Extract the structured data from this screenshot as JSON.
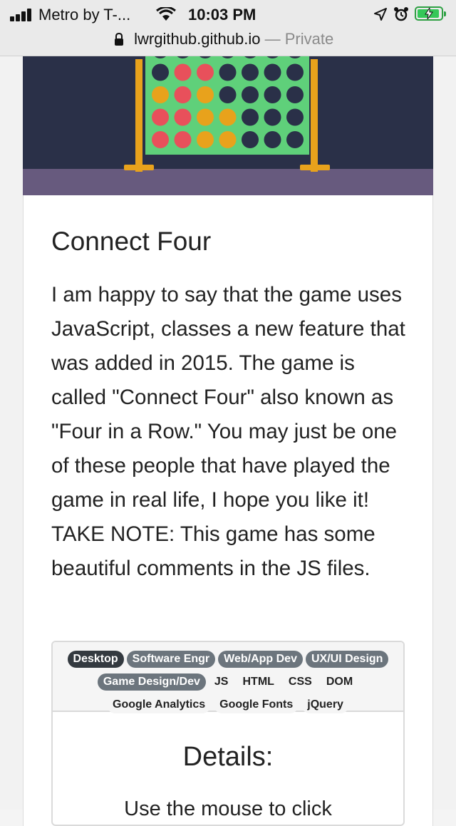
{
  "status_bar": {
    "carrier": "Metro by T-...",
    "time": "10:03 PM"
  },
  "url_bar": {
    "domain": "lwrgithub.github.io",
    "separator": "—",
    "mode": "Private"
  },
  "banner": {
    "board_color": "#5fd07a",
    "stand_color": "#e8a21c",
    "background_color": "#2a3048",
    "floor_color": "#675a7e",
    "piece_colors": {
      "R": "#e8505b",
      "Y": "#e8a21c",
      "E": "#2a3048"
    },
    "board_rows": [
      "EEEEEEE",
      "ERREEEE",
      "YRYEEEE",
      "RRYYEEE",
      "RRYYEEE"
    ]
  },
  "project": {
    "title": "Connect Four",
    "description": "I am happy to say that the game uses JavaScript, classes a new feature that was added in 2015. The game is called \"Connect Four\" also known as \"Four in a Row.\" You may just be one of these people that have played the game in real life, I hope you like it! TAKE NOTE: This game has some beautiful comments in the JS files."
  },
  "tags": {
    "row1": [
      {
        "label": "Desktop",
        "style": "dark"
      },
      {
        "label": "Software Engr",
        "style": "gray"
      },
      {
        "label": "Web/App Dev",
        "style": "gray"
      },
      {
        "label": "UX/UI Design",
        "style": "gray"
      }
    ],
    "row2": [
      {
        "label": "Game Design/Dev",
        "style": "gray"
      },
      {
        "label": "JS",
        "style": "light"
      },
      {
        "label": "HTML",
        "style": "light"
      },
      {
        "label": "CSS",
        "style": "light"
      },
      {
        "label": "DOM",
        "style": "light"
      }
    ],
    "row3": [
      {
        "label": "Google Analytics",
        "style": "light"
      },
      {
        "label": "Google Fonts",
        "style": "light"
      },
      {
        "label": "jQuery",
        "style": "light"
      }
    ]
  },
  "details": {
    "heading": "Details:",
    "text": "Use the mouse to click"
  }
}
